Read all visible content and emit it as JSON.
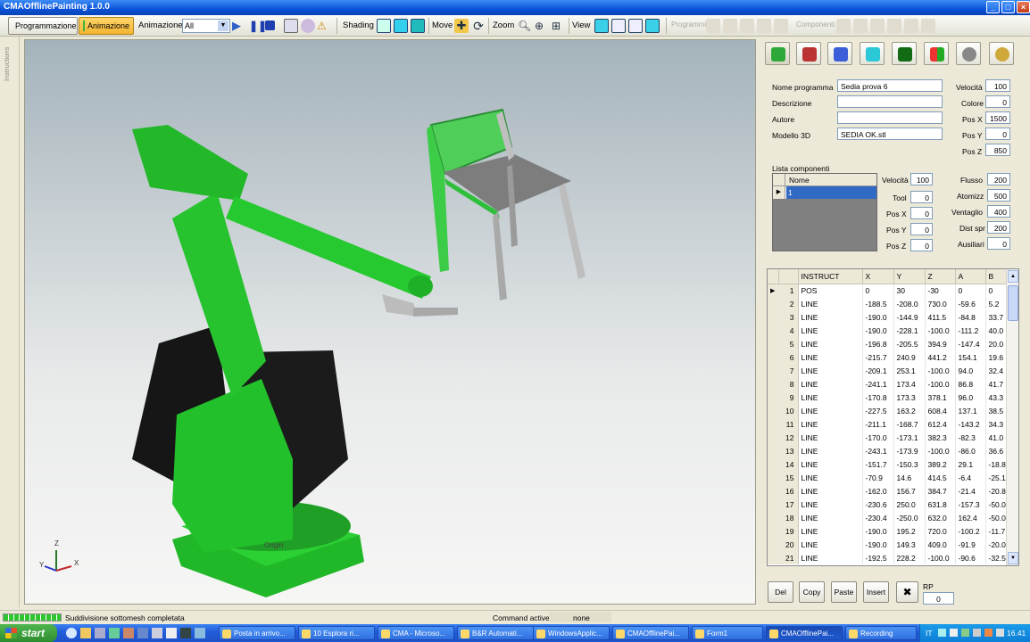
{
  "window": {
    "title": "CMAOfflinePainting 1.0.0"
  },
  "toolbar": {
    "programmazione": "Programmazione",
    "animazione_btn": "Animazione",
    "animazione_label": "Animazione",
    "anim_select": "All",
    "shading": "Shading",
    "move": "Move",
    "zoom": "Zoom",
    "view": "View",
    "programs_disabled": "Programmi",
    "components_disabled": "Componenti"
  },
  "left_strip": {
    "label": "Instructions"
  },
  "viewport": {
    "origin_label": "Origin",
    "axis_z": "Z",
    "axis_x": "X",
    "axis_y": "Y"
  },
  "program": {
    "nome_label": "Nome programma",
    "nome_value": "Sedia prova 6",
    "descr_label": "Descrizione",
    "descr_value": "",
    "autore_label": "Autore",
    "autore_value": "",
    "modello_label": "Modello 3D",
    "modello_value": "SEDIA OK.stl",
    "velocita_label": "Velocità",
    "velocita_value": "100",
    "colore_label": "Colore",
    "colore_value": "0",
    "posx_label": "Pos X",
    "posx_value": "1500",
    "posy_label": "Pos Y",
    "posy_value": "0",
    "posz_label": "Pos Z",
    "posz_value": "850"
  },
  "components": {
    "title": "Lista componenti",
    "col_name": "Nome",
    "row_value": "1",
    "velocita_label": "Velocità",
    "velocita_value": "100",
    "tool_label": "Tool",
    "tool_value": "0",
    "posx_label": "Pos X",
    "posx_value": "0",
    "posy_label": "Pos Y",
    "posy_value": "0",
    "posz_label": "Pos Z",
    "posz_value": "0",
    "flusso_label": "Flusso",
    "flusso_value": "200",
    "atomizz_label": "Atomizz",
    "atomizz_value": "500",
    "ventaglio_label": "Ventaglio",
    "ventaglio_value": "400",
    "distspr_label": "Dist spr",
    "distspr_value": "200",
    "ausiliari_label": "Ausiliari",
    "ausiliari_value": "0"
  },
  "instructions": {
    "columns": [
      "INSTRUCT",
      "X",
      "Y",
      "Z",
      "A",
      "B"
    ],
    "rows": [
      [
        "1",
        "POS",
        "0",
        "30",
        "-30",
        "0",
        "0"
      ],
      [
        "2",
        "LINE",
        "-188.5",
        "-208.0",
        "730.0",
        "-59.6",
        "5.2"
      ],
      [
        "3",
        "LINE",
        "-190.0",
        "-144.9",
        "411.5",
        "-84.8",
        "33.7"
      ],
      [
        "4",
        "LINE",
        "-190.0",
        "-228.1",
        "-100.0",
        "-111.2",
        "40.0"
      ],
      [
        "5",
        "LINE",
        "-196.8",
        "-205.5",
        "394.9",
        "-147.4",
        "20.0"
      ],
      [
        "6",
        "LINE",
        "-215.7",
        "240.9",
        "441.2",
        "154.1",
        "19.6"
      ],
      [
        "7",
        "LINE",
        "-209.1",
        "253.1",
        "-100.0",
        "94.0",
        "32.4"
      ],
      [
        "8",
        "LINE",
        "-241.1",
        "173.4",
        "-100.0",
        "86.8",
        "41.7"
      ],
      [
        "9",
        "LINE",
        "-170.8",
        "173.3",
        "378.1",
        "96.0",
        "43.3"
      ],
      [
        "10",
        "LINE",
        "-227.5",
        "163.2",
        "608.4",
        "137.1",
        "38.5"
      ],
      [
        "11",
        "LINE",
        "-211.1",
        "-168.7",
        "612.4",
        "-143.2",
        "34.3"
      ],
      [
        "12",
        "LINE",
        "-170.0",
        "-173.1",
        "382.3",
        "-82.3",
        "41.0"
      ],
      [
        "13",
        "LINE",
        "-243.1",
        "-173.9",
        "-100.0",
        "-86.0",
        "36.6"
      ],
      [
        "14",
        "LINE",
        "-151.7",
        "-150.3",
        "389.2",
        "29.1",
        "-18.8"
      ],
      [
        "15",
        "LINE",
        "-70.9",
        "14.6",
        "414.5",
        "-6.4",
        "-25.1"
      ],
      [
        "16",
        "LINE",
        "-162.0",
        "156.7",
        "384.7",
        "-21.4",
        "-20.8"
      ],
      [
        "17",
        "LINE",
        "-230.6",
        "250.0",
        "631.8",
        "-157.3",
        "-50.0"
      ],
      [
        "18",
        "LINE",
        "-230.4",
        "-250.0",
        "632.0",
        "162.4",
        "-50.0"
      ],
      [
        "19",
        "LINE",
        "-190.0",
        "195.2",
        "720.0",
        "-100.2",
        "-11.7"
      ],
      [
        "20",
        "LINE",
        "-190.0",
        "149.3",
        "409.0",
        "-91.9",
        "-20.0"
      ],
      [
        "21",
        "LINE",
        "-192.5",
        "228.2",
        "-100.0",
        "-90.6",
        "-32.5"
      ]
    ]
  },
  "actions": {
    "del": "Del",
    "copy": "Copy",
    "paste": "Paste",
    "insert": "Insert",
    "rp_label": "RP",
    "rp_value": "0"
  },
  "status": {
    "message": "Suddivisione sottomesh completata",
    "cmd_label": "Command active :",
    "cmd_value": "none"
  },
  "taskbar": {
    "start": "start",
    "tasks": [
      "Posta in arrivo...",
      "10 Esplora ri...",
      "CMA - Microso...",
      "B&R Automati...",
      "WindowsApplic...",
      "CMAOfflinePai...",
      "Form1",
      "CMAOfflinePai...",
      "Recording"
    ],
    "lang": "IT",
    "clock": "16.41"
  },
  "colors": {
    "robot": "#22c022",
    "robot_dark": "#1a1a1a",
    "chair_seat": "#8a8a8a",
    "accent": "#316ac5"
  }
}
